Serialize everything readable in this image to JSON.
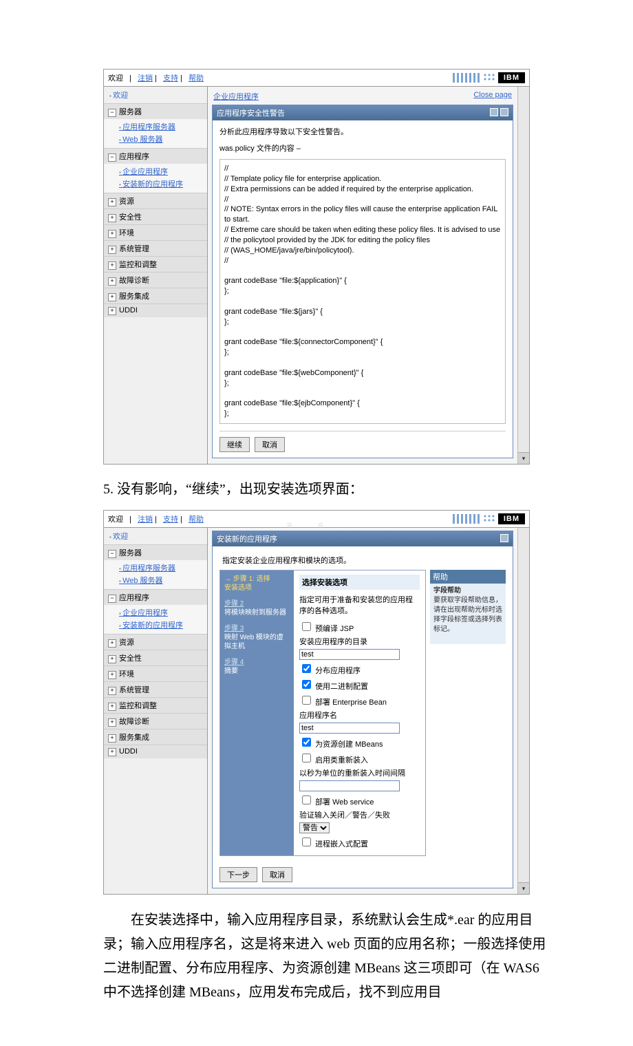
{
  "topbar": {
    "welcome": "欢迎",
    "logout": "注销",
    "support": "支持",
    "help": "帮助",
    "ibm": "IBM"
  },
  "sidebar": {
    "welcome": "欢迎",
    "groups": [
      {
        "sym": "⊟",
        "label": "服务器",
        "children": [
          "应用程序服务器",
          "Web 服务器"
        ]
      },
      {
        "sym": "⊟",
        "label": "应用程序",
        "children": [
          "企业应用程序",
          "安装新的应用程序"
        ]
      },
      {
        "sym": "⊞",
        "label": "资源",
        "children": []
      },
      {
        "sym": "⊞",
        "label": "安全性",
        "children": []
      },
      {
        "sym": "⊞",
        "label": "环境",
        "children": []
      },
      {
        "sym": "⊞",
        "label": "系统管理",
        "children": []
      },
      {
        "sym": "⊞",
        "label": "监控和调整",
        "children": []
      },
      {
        "sym": "⊞",
        "label": "故障诊断",
        "children": []
      },
      {
        "sym": "⊞",
        "label": "服务集成",
        "children": []
      },
      {
        "sym": "⊞",
        "label": "UDDI",
        "children": []
      }
    ]
  },
  "shot1": {
    "breadcrumb": "企业应用程序",
    "close": "Close page",
    "panel_title": "应用程序安全性警告",
    "warn": "分析此应用程序导致以下安全性警告。",
    "policy_label": "was.policy 文件的内容  –",
    "policy_text": "//\n// Template policy file for enterprise application.\n// Extra permissions can be added if required by the enterprise application.\n//\n// NOTE: Syntax errors in the policy files will cause the enterprise application FAIL to start.\n// Extreme care should be taken when editing these policy files. It is advised to use\n// the policytool provided by the JDK for editing the policy files\n// (WAS_HOME/java/jre/bin/policytool).\n//\n\ngrant codeBase \"file:${application}\" {\n};\n\ngrant codeBase \"file:${jars}\" {\n};\n\ngrant codeBase \"file:${connectorComponent}\" {\n};\n\ngrant codeBase \"file:${webComponent}\" {\n};\n\ngrant codeBase \"file:${ejbComponent}\" {\n};",
    "continue": "继续",
    "cancel": "取消"
  },
  "caption1": "5. 没有影响，“继续”，出现安装选项界面：",
  "shot2": {
    "panel_title": "安装新的应用程序",
    "subtitle": "指定安装企业应用程序和模块的选项。",
    "steps": {
      "s1a": "步骤 1: 选择",
      "s1b": "安装选项",
      "s2a": "步骤 2",
      "s2b": "将模块映射到服务器",
      "s3a": "步骤 3",
      "s3b": "映射 Web 模块的虚拟主机",
      "s4a": "步骤 4",
      "s4b": "摘要"
    },
    "form": {
      "heading": "选择安装选项",
      "desc": "指定可用于准备和安装您的应用程序的各种选项。",
      "precompile": "预编译 JSP",
      "dir_label": "安装应用程序的目录",
      "dir_value": "test",
      "dist": "分布应用程序",
      "binary": "使用二进制配置",
      "ejb": "部署 Enterprise Bean",
      "appname_label": "应用程序名",
      "appname_value": "test",
      "mbeans": "为资源创建 MBeans",
      "classreload": "启用类重新装入",
      "reload_label": "以秒为单位的重新装入时间间隔",
      "reload_value": "",
      "ws": "部署 Web service",
      "validate_label": "验证输入关闭／警告／失败",
      "validate_value": "警告",
      "embed": "进程嵌入式配置",
      "next": "下一步",
      "cancel": "取消"
    },
    "help": {
      "title": "帮助",
      "fieldhelp": "字段帮助",
      "body": "要获取字段帮助信息，请在出现帮助光标时选择字段标签或选择列表标记。"
    },
    "watermark": "www.bdocx.co"
  },
  "caption2": "在安装选择中，输入应用程序目录，系统默认会生成*.ear 的应用目录；输入应用程序名，这是将来进入 web 页面的应用名称；一般选择使用二进制配置、分布应用程序、为资源创建 MBeans 这三项即可（在 WAS6 中不选择创建 MBeans，应用发布完成后，找不到应用目"
}
